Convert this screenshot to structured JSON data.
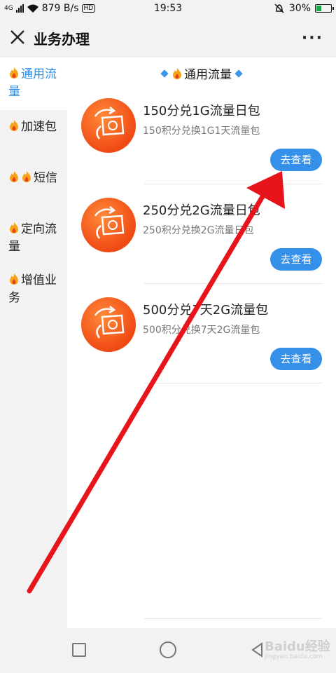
{
  "status_bar": {
    "network": "4G",
    "speed": "879 B/s",
    "volte": "HD",
    "time": "19:53",
    "battery": "30%"
  },
  "titlebar": {
    "title": "业务办理",
    "close_icon": "close-icon",
    "more_label": "···"
  },
  "sidebar": {
    "items": [
      {
        "label": "通用流量",
        "active": true
      },
      {
        "label": "加速包"
      },
      {
        "label": "短信"
      },
      {
        "label": "定向流量"
      },
      {
        "label": "增值业务"
      }
    ]
  },
  "content": {
    "section_title": "通用流量",
    "products": [
      {
        "name": "150分兑1G流量日包",
        "desc": "150积分兑换1G1天流量包",
        "button": "去查看"
      },
      {
        "name": "250分兑2G流量日包",
        "desc": "250积分兑换2G流量日包",
        "button": "去查看"
      },
      {
        "name": "500分兑7天2G流量包",
        "desc": "500积分兑换7天2G流量包",
        "button": "去查看"
      }
    ]
  },
  "nav_bar": {
    "watermark": "Baidu经验",
    "watermark_sub": "jingyan.baidu.com"
  },
  "colors": {
    "accent": "#3590ea",
    "sidebar_active": "#2b8fe8",
    "icon_orange": "#f04a14",
    "annotation_red": "#e8141b"
  }
}
